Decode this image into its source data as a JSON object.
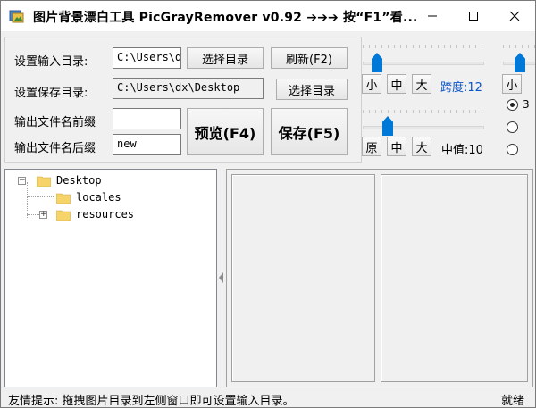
{
  "window": {
    "title": "图片背景漂白工具 PicGrayRemover v0.92  ➔➔➔ 按“F1”看...",
    "minimize_glyph": "—",
    "maximize_glyph": "☐",
    "close_glyph": "✕"
  },
  "settings": {
    "input_dir_label": "设置输入目录:",
    "input_dir_value": "C:\\Users\\d",
    "choose_dir_label": "选择目录",
    "refresh_label": "刷新(F2)",
    "save_dir_label": "设置保存目录:",
    "save_dir_value": "C:\\Users\\dx\\Desktop",
    "choose_save_dir_label": "选择目录",
    "prefix_label": "输出文件名前缀",
    "prefix_value": "",
    "suffix_label": "输出文件名后缀",
    "suffix_value": "new",
    "preview_label": "预览(F4)",
    "save_label": "保存(F5)"
  },
  "span_controls": {
    "small": "小",
    "medium": "中",
    "large": "大",
    "span_text": "跨度:12",
    "span_value": 0.12
  },
  "mid_controls": {
    "original": "原",
    "medium": "中",
    "large": "大",
    "mid_text": "中值:10",
    "mid_value": 0.18
  },
  "right_controls": {
    "small": "小",
    "radio1": "3",
    "radio2": "",
    "radio3": ""
  },
  "tree": {
    "root": "Desktop",
    "children": [
      "locales",
      "resources"
    ],
    "expand_glyph": "⊟",
    "collapsed_glyph": "⊞"
  },
  "status": {
    "tip": "友情提示: 拖拽图片目录到左侧窗口即可设置输入目录。",
    "state": "就绪"
  },
  "colors": {
    "accent": "#0078d7",
    "span_text_color": "#0a55c8",
    "folder": "#f6d46a"
  }
}
